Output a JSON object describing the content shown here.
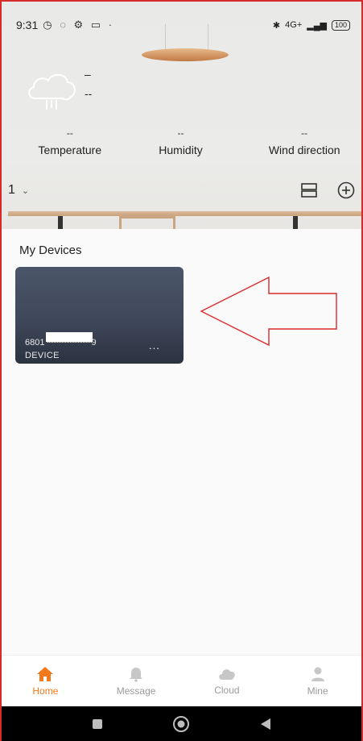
{
  "status_bar": {
    "time": "9:31",
    "left_icons": [
      "alarm-icon",
      "whatsapp-icon",
      "settings-icon",
      "screen-icon",
      "dot-icon"
    ],
    "network": "4G+",
    "battery": "100"
  },
  "weather": {
    "icon": "rain-cloud-icon",
    "line1": "–",
    "line2": "--"
  },
  "metrics": [
    {
      "value": "--",
      "label": "Temperature"
    },
    {
      "value": "--",
      "label": "Humidity"
    },
    {
      "value": "--",
      "label": "Wind direction"
    }
  ],
  "toolbar": {
    "room": "1",
    "layout_icon": "list-layout-icon",
    "add_icon": "add-circle-icon"
  },
  "devices_section": {
    "title": "My Devices",
    "cards": [
      {
        "id_prefix": "6801",
        "id_suffix": "9",
        "type": "DEVICE",
        "more": "..."
      }
    ]
  },
  "nav": {
    "items": [
      {
        "label": "Home",
        "icon": "home-icon",
        "active": true
      },
      {
        "label": "Message",
        "icon": "bell-icon",
        "active": false
      },
      {
        "label": "Cloud",
        "icon": "cloud-icon",
        "active": false
      },
      {
        "label": "Mine",
        "icon": "person-icon",
        "active": false
      }
    ]
  },
  "colors": {
    "accent": "#f27a1a",
    "annotation": "#d92a2a",
    "card": "#3f485a"
  }
}
